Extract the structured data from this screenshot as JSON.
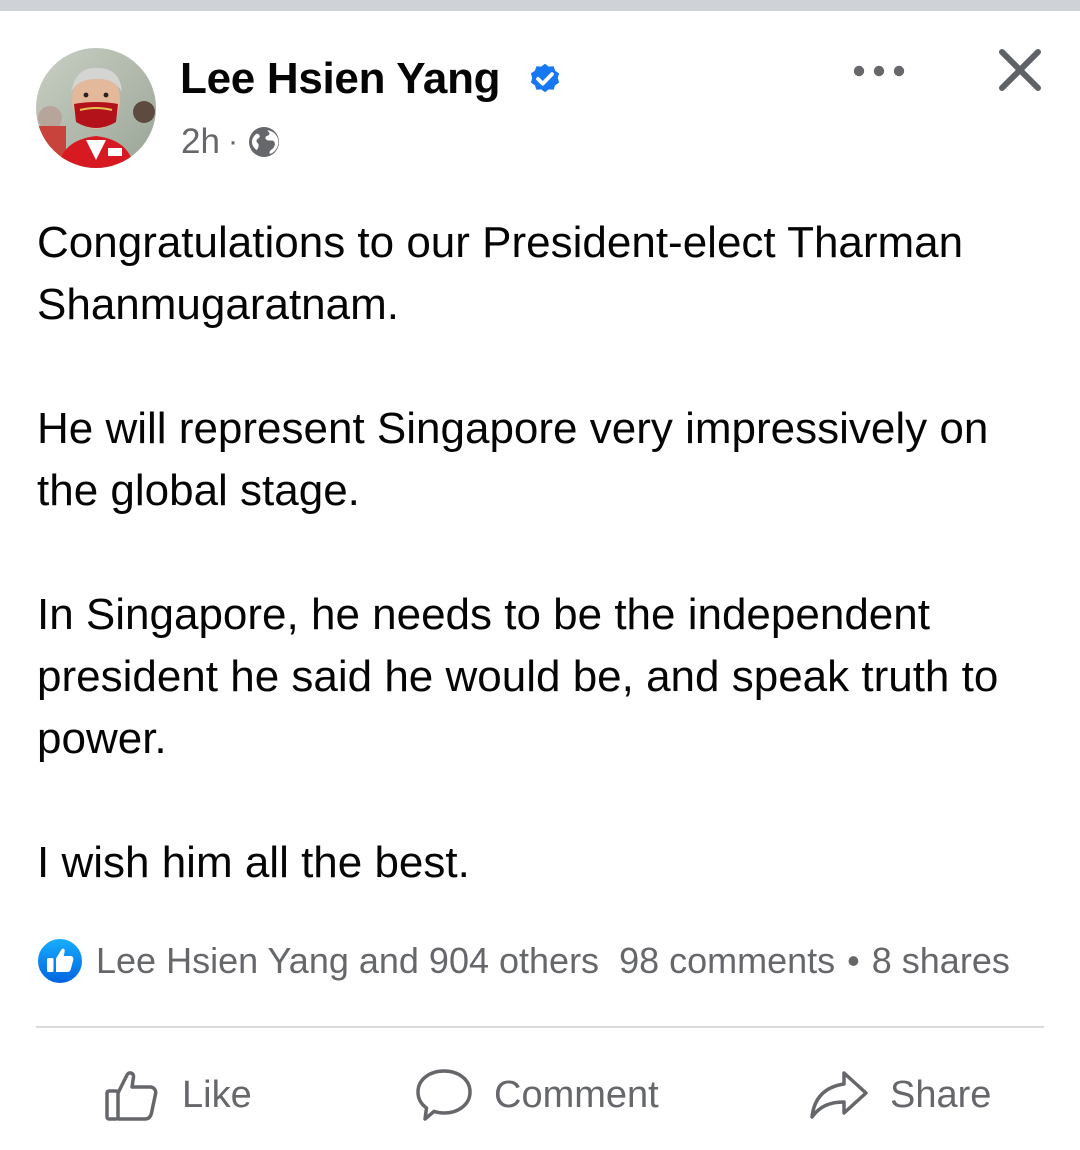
{
  "post": {
    "author_name": "Lee Hsien Yang",
    "verified": true,
    "timestamp": "2h",
    "separator": "·",
    "audience_icon": "globe-icon",
    "paragraphs": [
      "Congratulations to our President-elect Tharman Shanmugaratnam.",
      "He will represent Singapore very impressively on the global stage.",
      "In Singapore, he needs to be the independent president he said he would be, and speak truth to power.",
      "I wish him all the best."
    ]
  },
  "reactions": {
    "icon": "like-reaction-icon",
    "summary": "Lee Hsien Yang and 904 others",
    "comments": "98 comments",
    "bullet": "•",
    "shares": "8 shares"
  },
  "actions": {
    "like_label": "Like",
    "comment_label": "Comment",
    "share_label": "Share"
  },
  "colors": {
    "accent_blue": "#1877f2",
    "secondary_text": "#65676b",
    "primary_text": "#050505",
    "divider": "#d9dbde"
  }
}
